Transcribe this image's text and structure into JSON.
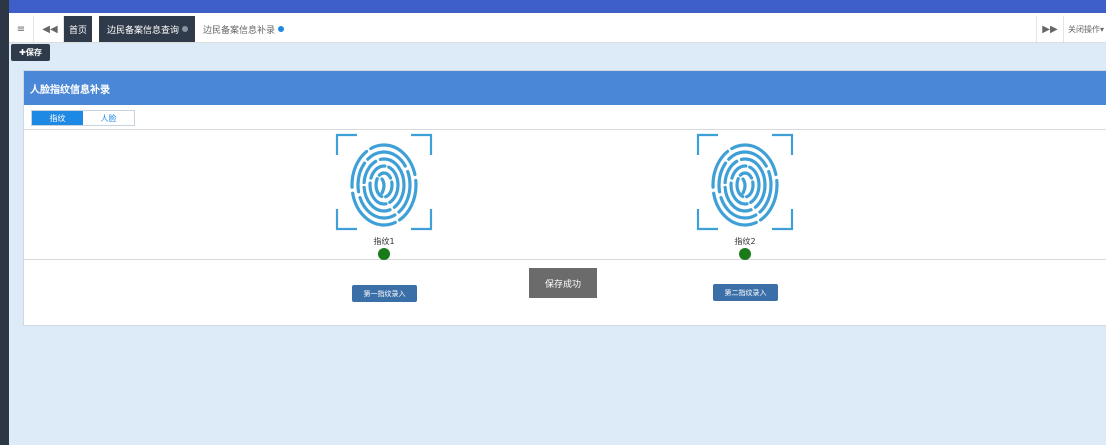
{
  "colors": {
    "sidebar": "#2c3645",
    "topStrip": "#3d5fc7",
    "panelHeader": "#4a87d6",
    "content": "#dcebf7",
    "success": "#1a7a1a",
    "fingerprint": "#3ea0d6"
  },
  "tabbar": {
    "menu_icon": "≡",
    "back_icon": "◀◀",
    "tabs": [
      {
        "label": "首页",
        "active": false
      },
      {
        "label": "边民备案信息查询",
        "active": false
      },
      {
        "label": "边民备案信息补录",
        "active": true
      }
    ],
    "forward_icon": "▶▶",
    "close_ops_label": "关闭操作▾"
  },
  "toolbar": {
    "save_label": "✚保存"
  },
  "panel": {
    "title": "人脸指纹信息补录",
    "subtabs": [
      "指纹",
      "人脸"
    ],
    "fingerprints": [
      {
        "label": "指纹1",
        "status": "success",
        "button": "第一指纹录入"
      },
      {
        "label": "指纹2",
        "status": "success",
        "button": "第二指纹录入"
      }
    ]
  },
  "toast": {
    "message": "保存成功"
  }
}
